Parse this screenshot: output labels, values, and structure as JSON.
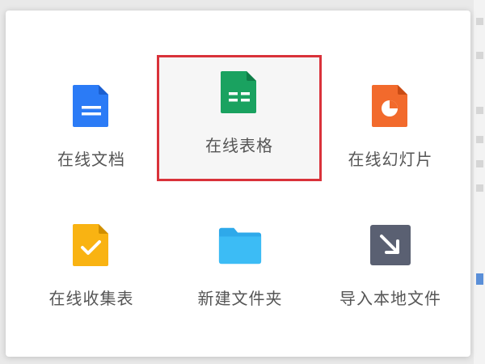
{
  "menu": {
    "items": [
      {
        "label": "在线文档",
        "icon": "document-icon",
        "color": "#2b7bf6"
      },
      {
        "label": "在线表格",
        "icon": "spreadsheet-icon",
        "color": "#1aa260",
        "selected": true
      },
      {
        "label": "在线幻灯片",
        "icon": "slides-icon",
        "color": "#f26a2c"
      },
      {
        "label": "在线收集表",
        "icon": "form-icon",
        "color": "#f9b312"
      },
      {
        "label": "新建文件夹",
        "icon": "folder-icon",
        "color": "#2ea9ea"
      },
      {
        "label": "导入本地文件",
        "icon": "import-icon",
        "color": "#5a6072"
      }
    ],
    "highlight_color": "#d9323a"
  }
}
